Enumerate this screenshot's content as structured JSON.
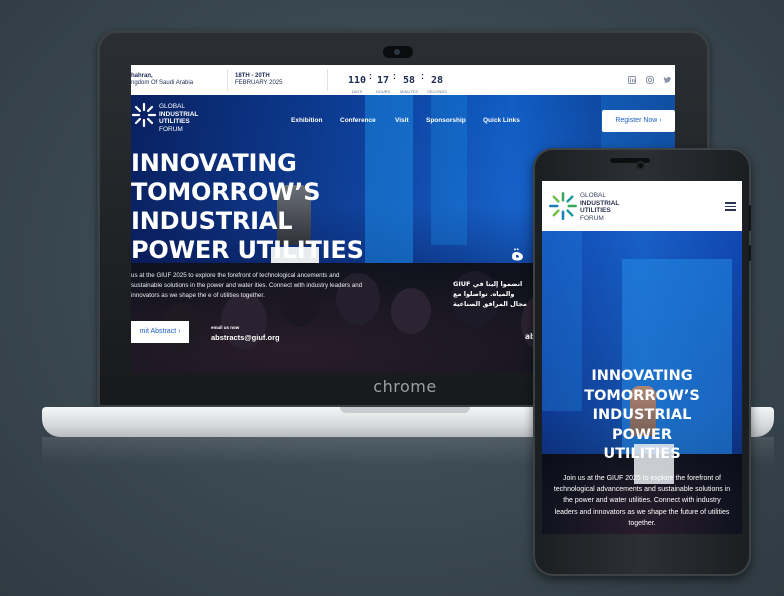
{
  "laptop": {
    "brand": "chrome",
    "site": {
      "location": {
        "line1": "hahran,",
        "line2": "ngdom Of Saudi Arabia"
      },
      "date": {
        "line1": "18TH - 20TH",
        "line2": "FEBRUARY 2025"
      },
      "countdown": {
        "days": "110",
        "hours": "17",
        "minutes": "58",
        "seconds": "28",
        "days_label": "DAYS",
        "hours_label": "HOURS",
        "minutes_label": "MINUTES",
        "seconds_label": "SECONDS"
      },
      "social_icons": [
        "linkedin-icon",
        "instagram-icon",
        "twitter-icon"
      ],
      "logo": {
        "line1": "GLOBAL",
        "line2": "INDUSTRIAL",
        "line3": "UTILITIES",
        "line4": "FORUM"
      },
      "nav": [
        "Exhibition",
        "Conference",
        "Visit",
        "Sponsorship",
        "Quick Links"
      ],
      "register_label": "Register Now ›",
      "hero_title": [
        "INNOVATING",
        "TOMORROW’S",
        "INDUSTRIAL",
        "POWER UTILITIES"
      ],
      "hero_desc": "us at the GIUF 2025 to explore the forefront of technological ancements and sustainable solutions in the power and water ities. Connect with industry leaders and innovators as we shape the e of utilities together.",
      "submit_label": "mit Abstract ›",
      "email_label": "email us now",
      "email": "abstracts@giuf.org",
      "arabic_heading": "ة",
      "arabic_lines": [
        "GIUF انضموا إلينا في",
        "والمياه. تواصلوا مع",
        "مجال المرافق الصناعية"
      ],
      "arabic_email_partial": "ab"
    }
  },
  "phone": {
    "logo": {
      "line1": "GLOBAL",
      "line2": "INDUSTRIAL",
      "line3": "UTILITIES",
      "line4": "FORUM"
    },
    "hero_title": [
      "INNOVATING",
      "TOMORROW’S",
      "INDUSTRIAL",
      "POWER",
      "UTILITIES"
    ],
    "hero_desc": "Join us at the GIUF 2025 to explore the forefront of technological advancements and sustainable solutions in the power and water utilities. Connect with industry leaders and innovators as we shape the future of utilities together."
  },
  "colors": {
    "accent": "#1e5fc2",
    "navy": "#1c2b55",
    "logo_green": "#3aa85a",
    "logo_teal": "#1b7fb8"
  }
}
